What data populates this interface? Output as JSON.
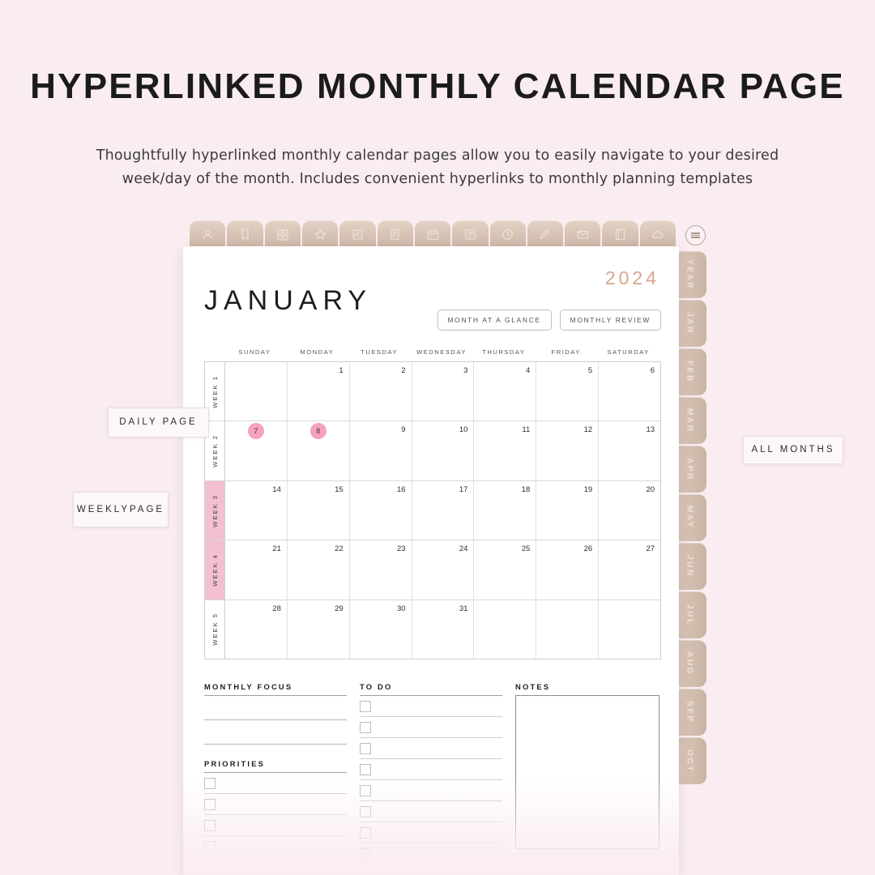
{
  "promo": {
    "title": "HYPERLINKED MONTHLY CALENDAR PAGE",
    "subtitle": "Thoughtfully hyperlinked monthly calendar pages allow you to easily navigate to your desired week/day of the month. Includes convenient hyperlinks to monthly planning templates"
  },
  "colors": {
    "background": "#faedf1",
    "tab_tan": "#d2bfb0",
    "highlight_pink": "#f2c0d1",
    "day_circle_pink": "#f5a2bb",
    "year_rose": "#d7a68c",
    "sheet_white": "#ffffff"
  },
  "callouts": {
    "daily": "DAILY PAGE",
    "weekly": "WEEKLY\nPAGE",
    "weekly_line1": "WEEKLY",
    "weekly_line2": "PAGE",
    "all_months": "ALL MONTHS"
  },
  "top_tabs": [
    {
      "icon": "person-icon"
    },
    {
      "icon": "bookmark-icon"
    },
    {
      "icon": "grid-icon"
    },
    {
      "icon": "star-icon"
    },
    {
      "icon": "chart-icon"
    },
    {
      "icon": "note-icon"
    },
    {
      "icon": "calendar-icon"
    },
    {
      "icon": "list-icon"
    },
    {
      "icon": "clock-icon"
    },
    {
      "icon": "pencil-icon"
    },
    {
      "icon": "envelope-icon"
    },
    {
      "icon": "book-icon"
    },
    {
      "icon": "cloud-icon"
    }
  ],
  "menu": {
    "icon": "hamburger-menu-icon"
  },
  "side_tabs": [
    "YEAR",
    "JAN",
    "FEB",
    "MAR",
    "APR",
    "MAY",
    "JUN",
    "JUL",
    "AUG",
    "SEP",
    "OCT"
  ],
  "calendar": {
    "year": "2024",
    "month": "JANUARY",
    "buttons": [
      {
        "label": "MONTH AT A GLANCE"
      },
      {
        "label": "MONTHLY REVIEW"
      }
    ],
    "weekdays": [
      "SUNDAY",
      "MONDAY",
      "TUESDAY",
      "WEDNESDAY",
      "THURSDAY",
      "FRIDAY",
      "SATURDAY"
    ],
    "weeks": [
      {
        "label": "WEEK 1",
        "highlighted": false,
        "days": [
          "",
          "1",
          "2",
          "3",
          "4",
          "5",
          "6"
        ],
        "circled": []
      },
      {
        "label": "WEEK 2",
        "highlighted": false,
        "days": [
          "7",
          "8",
          "9",
          "10",
          "11",
          "12",
          "13"
        ],
        "circled": [
          "7",
          "8"
        ]
      },
      {
        "label": "WEEK 3",
        "highlighted": true,
        "days": [
          "14",
          "15",
          "16",
          "17",
          "18",
          "19",
          "20"
        ],
        "circled": []
      },
      {
        "label": "WEEK 4",
        "highlighted": true,
        "days": [
          "21",
          "22",
          "23",
          "24",
          "25",
          "26",
          "27"
        ],
        "circled": []
      },
      {
        "label": "WEEK 5",
        "highlighted": false,
        "days": [
          "28",
          "29",
          "30",
          "31",
          "",
          "",
          ""
        ],
        "circled": []
      }
    ]
  },
  "sections": {
    "monthly_focus": {
      "title": "MONTHLY FOCUS",
      "blank_lines": 2
    },
    "priorities": {
      "title": "PRIORITIES",
      "checkbox_rows": 4
    },
    "todo": {
      "title": "TO DO",
      "checkbox_rows": 8
    },
    "notes": {
      "title": "NOTES"
    }
  }
}
